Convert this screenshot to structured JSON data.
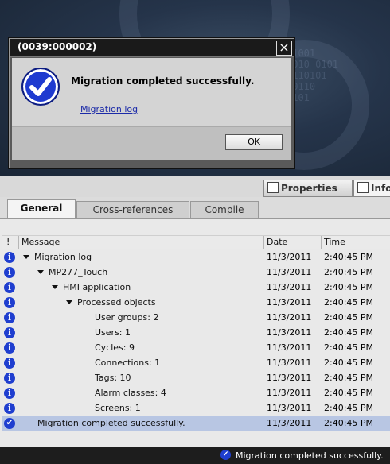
{
  "dialog": {
    "title": "(0039:000002)",
    "close_glyph": "×",
    "message": "Migration completed successfully.",
    "link": "Migration log",
    "ok_label": "OK"
  },
  "panel_tabs": {
    "properties": "Properties",
    "info": "Info"
  },
  "sub_tabs": [
    "General",
    "Cross-references",
    "Compile"
  ],
  "columns": {
    "flag": "!",
    "message": "Message",
    "date": "Date",
    "time": "Time"
  },
  "rows": [
    {
      "icon": "info-icon",
      "expander": true,
      "message": "Migration log",
      "date": "11/3/2011",
      "time": "2:40:45 PM"
    },
    {
      "icon": "info-icon",
      "expander": true,
      "message": "MP277_Touch",
      "date": "11/3/2011",
      "time": "2:40:45 PM"
    },
    {
      "icon": "info-icon",
      "expander": true,
      "message": "HMI application",
      "date": "11/3/2011",
      "time": "2:40:45 PM"
    },
    {
      "icon": "info-icon",
      "expander": true,
      "message": "Processed objects",
      "date": "11/3/2011",
      "time": "2:40:45 PM"
    },
    {
      "icon": "info-icon",
      "expander": false,
      "message": "User groups: 2",
      "date": "11/3/2011",
      "time": "2:40:45 PM"
    },
    {
      "icon": "info-icon",
      "expander": false,
      "message": "Users: 1",
      "date": "11/3/2011",
      "time": "2:40:45 PM"
    },
    {
      "icon": "info-icon",
      "expander": false,
      "message": "Cycles: 9",
      "date": "11/3/2011",
      "time": "2:40:45 PM"
    },
    {
      "icon": "info-icon",
      "expander": false,
      "message": "Connections: 1",
      "date": "11/3/2011",
      "time": "2:40:45 PM"
    },
    {
      "icon": "info-icon",
      "expander": false,
      "message": "Tags: 10",
      "date": "11/3/2011",
      "time": "2:40:45 PM"
    },
    {
      "icon": "info-icon",
      "expander": false,
      "message": "Alarm classes: 4",
      "date": "11/3/2011",
      "time": "2:40:45 PM"
    },
    {
      "icon": "info-icon",
      "expander": false,
      "message": "Screens: 1",
      "date": "11/3/2011",
      "time": "2:40:45 PM"
    },
    {
      "icon": "check-icon",
      "expander": false,
      "message": "Migration completed successfully.",
      "date": "11/3/2011",
      "time": "2:40:45 PM",
      "selected": true
    }
  ],
  "status_bar": {
    "message": "Migration completed successfully."
  },
  "colors": {
    "accent_blue": "#1f3ecf",
    "selection": "#b8c6e3"
  }
}
